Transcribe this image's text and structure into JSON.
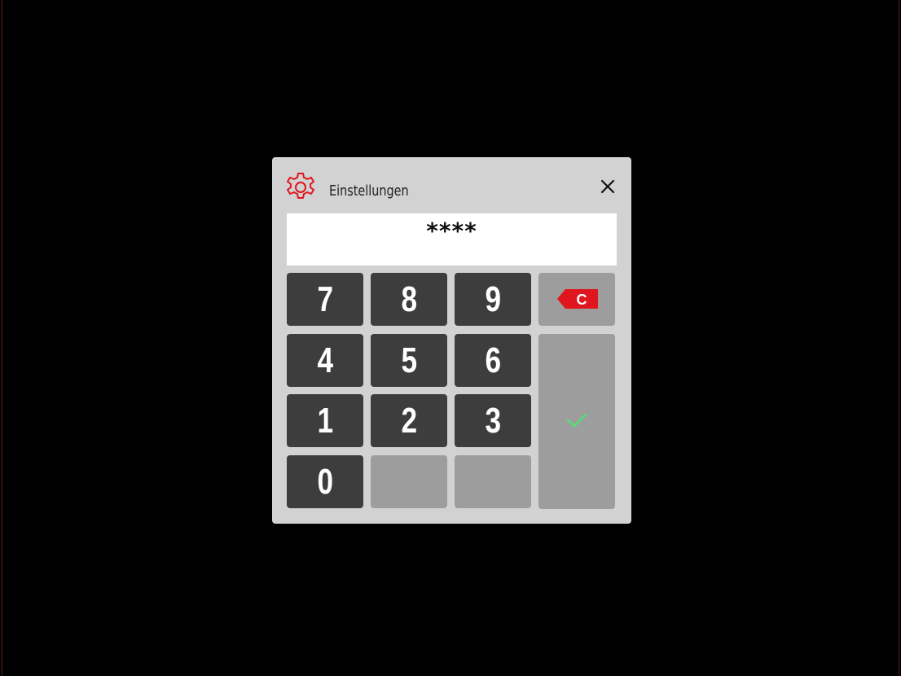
{
  "dialog": {
    "title": "Einstellungen",
    "icon": "gear-icon",
    "close_icon": "close-icon",
    "display_value": "****"
  },
  "keypad": {
    "k7": "7",
    "k8": "8",
    "k9": "9",
    "k4": "4",
    "k5": "5",
    "k6": "6",
    "k1": "1",
    "k2": "2",
    "k3": "3",
    "k0": "0",
    "clear_label": "C",
    "clear_icon": "backspace-clear-icon",
    "ok_icon": "checkmark-icon"
  },
  "colors": {
    "background": "#000000",
    "dialog": "#d2d2d2",
    "key": "#3d3d3d",
    "key_inactive": "#9d9d9d",
    "accent_red": "#e0161e",
    "ok_green": "#5ed67a"
  }
}
